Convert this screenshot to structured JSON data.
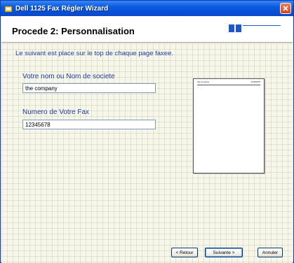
{
  "window": {
    "title": "Dell 1125 Fax Régler Wizard"
  },
  "header": {
    "step_title": "Procede 2: Personnalisation",
    "progress_fraction": 0.25
  },
  "content": {
    "instruction": "Le suivant est place sur le top de chaque page faxee.",
    "name_label": "Votre nom ou Nom de societe",
    "name_value": "the company",
    "fax_label": "Numero de Votre Fax",
    "fax_value": "12345678"
  },
  "preview": {
    "header_name": "the company",
    "header_fax": "12345678"
  },
  "buttons": {
    "back": "< Retour",
    "next": "Suivante >",
    "cancel": "Annuler"
  },
  "colors": {
    "title_bar": "#0a5be0",
    "label_text": "#1e3fa8",
    "progress": "#1d57c8"
  },
  "icons": {
    "app": "fax-wizard-icon",
    "close": "close-icon"
  }
}
